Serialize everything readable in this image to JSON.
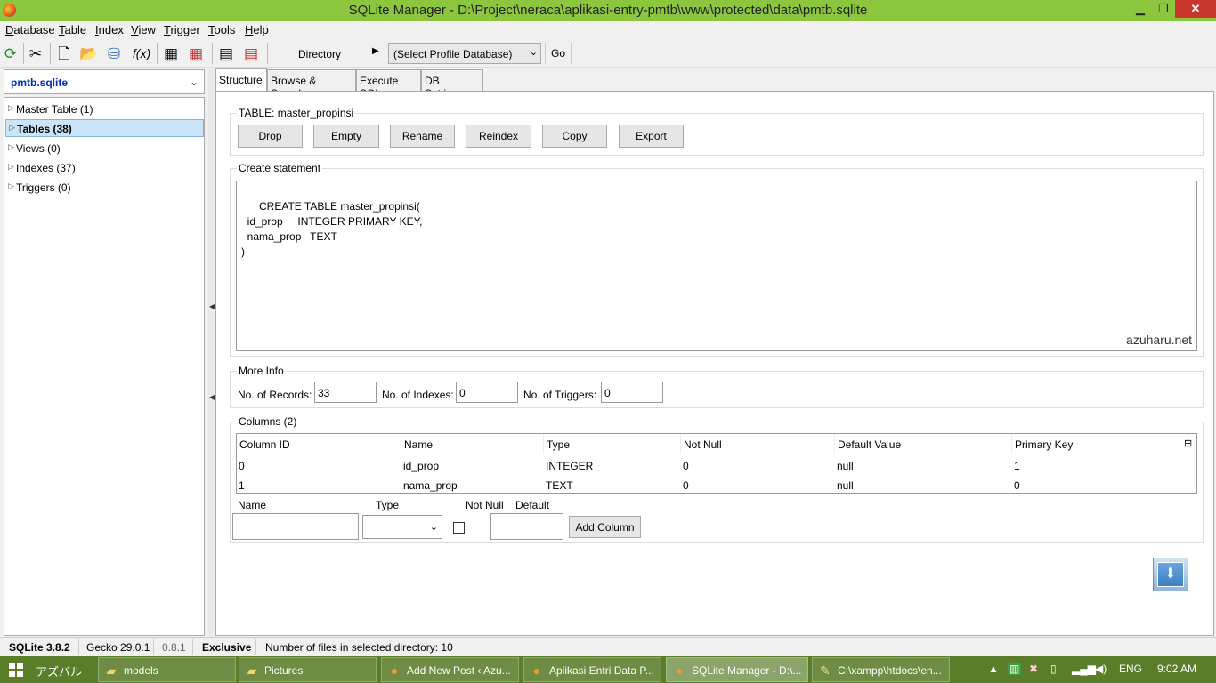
{
  "window": {
    "title": "SQLite Manager - D:\\Project\\neraca\\aplikasi-entry-pmtb\\www\\protected\\data\\pmtb.sqlite",
    "minimize": "▁",
    "maximize": "❐",
    "close": "✕"
  },
  "menu": [
    "Database",
    "Table",
    "Index",
    "View",
    "Trigger",
    "Tools",
    "Help"
  ],
  "toolbar": {
    "directory_label": "Directory",
    "profile_select": "(Select Profile Database)",
    "go_label": "Go"
  },
  "sidebar": {
    "db_name": "pmtb.sqlite",
    "items": [
      {
        "label": "Master Table (1)"
      },
      {
        "label": "Tables (38)"
      },
      {
        "label": "Views (0)"
      },
      {
        "label": "Indexes (37)"
      },
      {
        "label": "Triggers (0)"
      }
    ]
  },
  "tabs": [
    "Structure",
    "Browse & Search",
    "Execute SQL",
    "DB Settings"
  ],
  "structure": {
    "table_title": "TABLE: master_propinsi",
    "buttons": [
      "Drop",
      "Empty",
      "Rename",
      "Reindex",
      "Copy",
      "Export"
    ],
    "create_title": "Create statement",
    "create_sql": "CREATE TABLE master_propinsi(\n  id_prop     INTEGER PRIMARY KEY,\n  nama_prop   TEXT\n)",
    "watermark": "azuharu.net",
    "more_info_title": "More Info",
    "records_label": "No. of Records:",
    "records_value": "33",
    "indexes_label": "No. of Indexes:",
    "indexes_value": "0",
    "triggers_label": "No. of Triggers:",
    "triggers_value": "0",
    "columns_title": "Columns (2)",
    "columns_headers": [
      "Column ID",
      "Name",
      "Type",
      "Not Null",
      "Default Value",
      "Primary Key"
    ],
    "columns_rows": [
      [
        "0",
        "id_prop",
        "INTEGER",
        "0",
        "null",
        "1"
      ],
      [
        "1",
        "nama_prop",
        "TEXT",
        "0",
        "null",
        "0"
      ]
    ],
    "add_name_label": "Name",
    "add_type_label": "Type",
    "add_notnull_label": "Not Null",
    "add_default_label": "Default",
    "add_column_button": "Add Column"
  },
  "status": {
    "sqlite": "SQLite 3.8.2",
    "gecko": "Gecko 29.0.1",
    "version": "0.8.1",
    "mode": "Exclusive",
    "files": "Number of files in selected directory: 10"
  },
  "taskbar": {
    "start_label": "アズバル",
    "tasks": [
      {
        "label": "models"
      },
      {
        "label": "Pictures"
      },
      {
        "label": "Add New Post ‹ Azu..."
      },
      {
        "label": "Aplikasi Entri Data P..."
      },
      {
        "label": "SQLite Manager - D:\\..."
      },
      {
        "label": "C:\\xampp\\htdocs\\en..."
      }
    ],
    "lang": "ENG",
    "clock": "9:02 AM"
  }
}
